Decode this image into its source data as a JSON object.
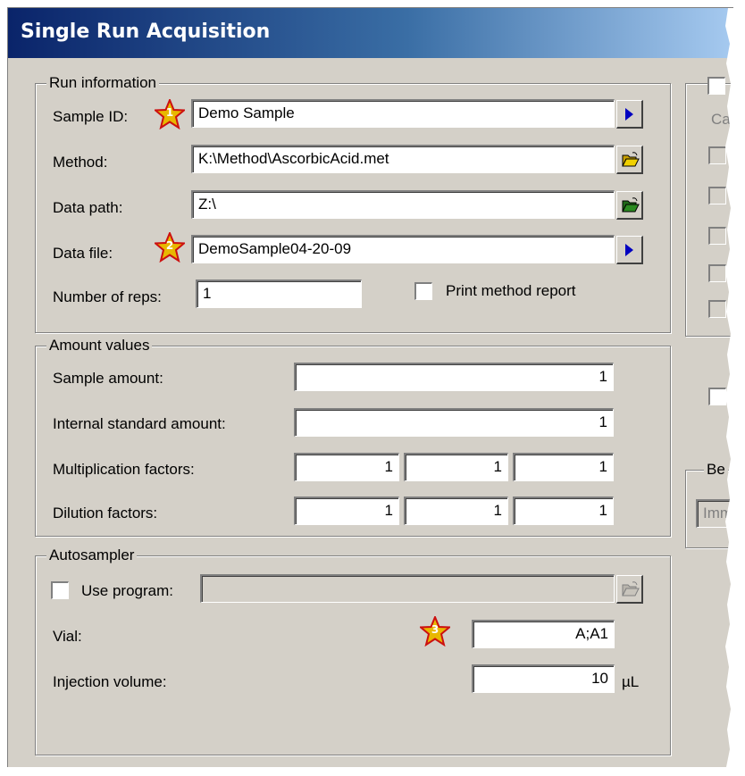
{
  "window": {
    "title": "Single Run Acquisition"
  },
  "run_information": {
    "legend": "Run information",
    "sample_id": {
      "label": "Sample ID:",
      "value": "Demo Sample",
      "marker": "1"
    },
    "method": {
      "label": "Method:",
      "value": "K:\\Method\\AscorbicAcid.met"
    },
    "data_path": {
      "label": "Data path:",
      "value": "Z:\\"
    },
    "data_file": {
      "label": "Data file:",
      "value": "DemoSample04-20-09",
      "marker": "2"
    },
    "number_of_reps": {
      "label": "Number of reps:",
      "value": "1"
    },
    "print_method_report": {
      "label": "Print method report",
      "checked": false
    }
  },
  "amount_values": {
    "legend": "Amount values",
    "sample_amount": {
      "label": "Sample amount:",
      "value": "1"
    },
    "internal_standard_amount": {
      "label": "Internal standard amount:",
      "value": "1"
    },
    "multiplication_factors": {
      "label": "Multiplication factors:",
      "values": [
        "1",
        "1",
        "1"
      ]
    },
    "dilution_factors": {
      "label": "Dilution factors:",
      "values": [
        "1",
        "1",
        "1"
      ]
    }
  },
  "autosampler": {
    "legend": "Autosampler",
    "use_program": {
      "label": "Use program:",
      "checked": false,
      "value": ""
    },
    "vial": {
      "label": "Vial:",
      "value": "A;A1",
      "marker": "3"
    },
    "injection_volume": {
      "label": "Injection volume:",
      "value": "10",
      "unit": "µL"
    }
  },
  "right_panel": {
    "partial_label": "Ca",
    "partial_group_legend": "Be",
    "partial_dropdown_value": "Imm"
  },
  "colors": {
    "dialog_bg": "#d4d0c8",
    "title_gradient_start": "#0a246a",
    "title_gradient_end": "#a6caf0",
    "marker_star": "#e8b800",
    "marker_star_outline": "#cc1010",
    "arrow_button": "#0000c0",
    "folder_yellow": "#f0d000",
    "folder_green": "#2a8a20"
  },
  "icons": [
    "arrow-right-icon",
    "folder-open-icon",
    "folder-green-icon",
    "star-marker-icon"
  ]
}
